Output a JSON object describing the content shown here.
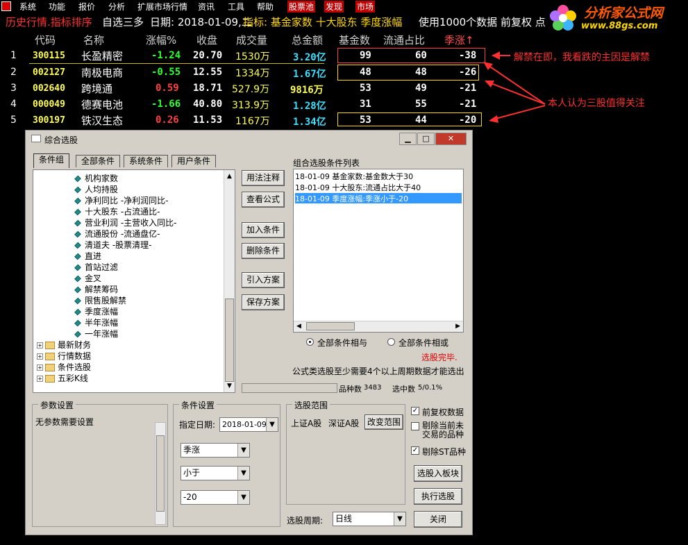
{
  "menubar": {
    "items": [
      "系统",
      "功能",
      "报价",
      "分析",
      "扩展市场行情",
      "资讯",
      "工具",
      "帮助"
    ],
    "highlight": [
      "股票池",
      "发现",
      "市场"
    ]
  },
  "titlebar": {
    "prefix": "历史行情.指标排序",
    "view": "自选三多",
    "date": "日期: 2018-01-09,二",
    "indicator": "指标: 基金家数 十大股东 季度涨幅",
    "usage": "使用1000个数据 前复权 点"
  },
  "watermark": {
    "brand": "分析家公式网",
    "url": "www.88gs.com"
  },
  "table": {
    "columns": [
      "代码",
      "名称",
      "涨幅%",
      "收盘",
      "成交量",
      "总金额",
      "基金数",
      "流通占比",
      "季涨↑"
    ],
    "rows": [
      {
        "idx": "1",
        "code": "300115",
        "name": "长盈精密",
        "chg": "-1.24",
        "close": "20.70",
        "vol": "1530万",
        "amt": "3.20亿",
        "funds": "99",
        "float": "60",
        "qchg": "-38"
      },
      {
        "idx": "2",
        "code": "002127",
        "name": "南极电商",
        "chg": "-0.55",
        "close": "12.55",
        "vol": "1334万",
        "amt": "1.67亿",
        "funds": "48",
        "float": "48",
        "qchg": "-26"
      },
      {
        "idx": "3",
        "code": "002640",
        "name": "跨境通",
        "chg": "0.59",
        "close": "18.71",
        "vol": "527.9万",
        "amt": "9816万",
        "funds": "53",
        "float": "49",
        "qchg": "-21"
      },
      {
        "idx": "4",
        "code": "000049",
        "name": "德赛电池",
        "chg": "-1.66",
        "close": "40.80",
        "vol": "313.9万",
        "amt": "1.28亿",
        "funds": "31",
        "float": "55",
        "qchg": "-21"
      },
      {
        "idx": "5",
        "code": "300197",
        "name": "铁汉生态",
        "chg": "0.26",
        "close": "11.53",
        "vol": "1167万",
        "amt": "1.34亿",
        "funds": "53",
        "float": "44",
        "qchg": "-20"
      }
    ]
  },
  "annotations": {
    "note1": "解禁在即，我看跌的主因是解禁",
    "note2": "本人认为三股值得关注"
  },
  "dialog": {
    "title": "综合选股",
    "tabs": [
      "条件组",
      "全部条件",
      "系统条件",
      "用户条件"
    ],
    "tree_items": [
      "机构家数",
      "人均持股",
      "净利同比 -净利润同比-",
      "十大股东 -占流通比-",
      "营业利润 -主营收入同比-",
      "流通股份 -流通盘亿-",
      "清道夫 -股票清理-",
      "直进",
      "首站过滤",
      "金叉",
      "解禁筹码",
      "限售股解禁",
      "季度涨幅",
      "半年涨幅",
      "一年涨幅"
    ],
    "tree_folders": [
      "最新财务",
      "行情数据",
      "条件选股",
      "五彩K线"
    ],
    "buttons_mid": [
      "用法注释",
      "查看公式",
      "加入条件",
      "删除条件",
      "引入方案",
      "保存方案"
    ],
    "list_title": "组合选股条件列表",
    "list_items": [
      "18-01-09  基金家数:基金数大于30",
      "18-01-09  十大股东:流通占比大于40",
      "18-01-09  季度涨幅:季涨小于-20"
    ],
    "radio_all": "全部条件相与",
    "radio_any": "全部条件相或",
    "status_done": "选股完毕.",
    "hint": "公式类选股至少需要4个以上周期数据才能选出",
    "count_label": "品种数",
    "count_value": "3483",
    "selected_label": "选中数",
    "selected_value": "5/0.1%",
    "params": {
      "title": "参数设置",
      "text": "无参数需要设置"
    },
    "cond": {
      "title": "条件设置",
      "date_label": "指定日期:",
      "date_value": "2018-01-09",
      "field1": "季涨",
      "field2": "小于",
      "field3": "-20"
    },
    "range": {
      "title": "选股范围",
      "sh": "上证A股",
      "sz": "深证A股",
      "change_btn": "改变范围",
      "period_label": "选股周期:",
      "period_value": "日线"
    },
    "checks": {
      "adj": "前复权数据",
      "exclude_untraded": "剔除当前未交易的品种",
      "exclude_st": "剔除ST品种"
    },
    "buttons_right": {
      "to_block": "选股入板块",
      "run": "执行选股",
      "close": "关闭"
    }
  },
  "colors": {
    "accent_red": "#ff3030",
    "select_blue": "#3399ff"
  }
}
